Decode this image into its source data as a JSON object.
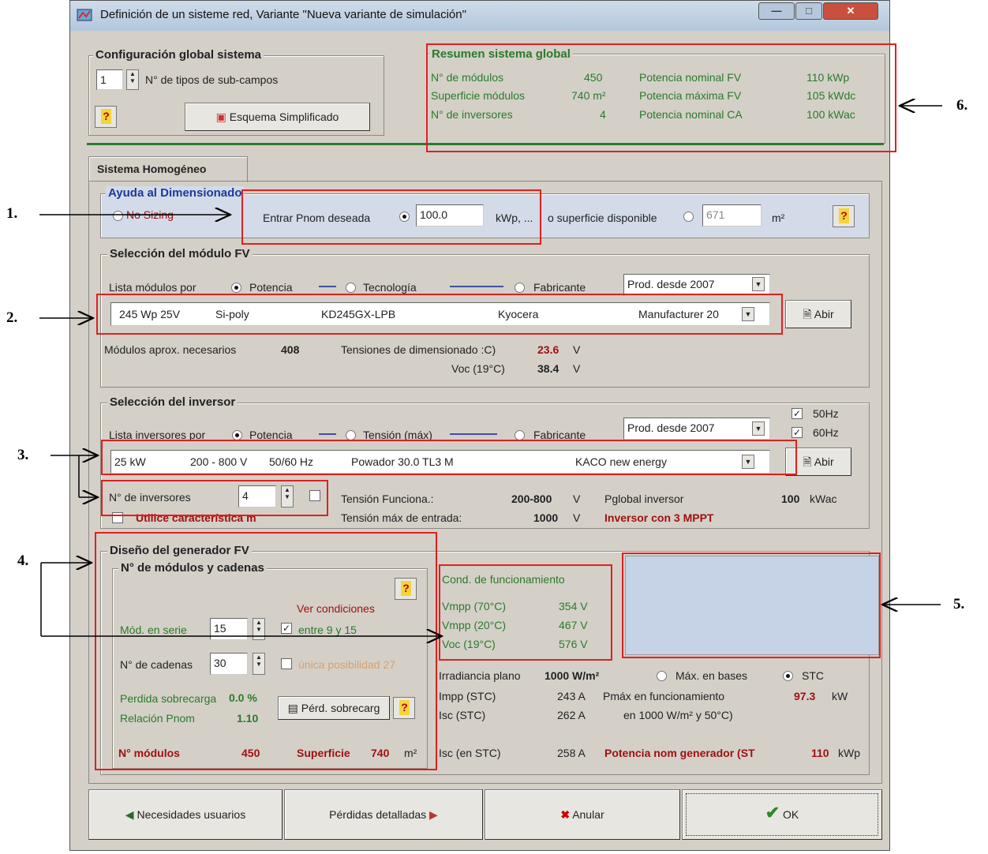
{
  "window": {
    "title": "Definición de un sisteme red, Variante   \"Nueva variante de simulación\""
  },
  "global_config": {
    "title": "Configuración global sistema",
    "subfield_count": "1",
    "subfield_label": "N° de tipos de sub-campos",
    "help": "?",
    "scheme_button": "Esquema Simplificado"
  },
  "summary": {
    "title": "Resumen sistema global",
    "rows": [
      {
        "label": "N° de módulos",
        "value": "450",
        "label2": "Potencia nominal FV",
        "value2": "110 kWp"
      },
      {
        "label": "Superficie módulos",
        "value": "740 m²",
        "label2": "Potencia máxima FV",
        "value2": "105 kWdc"
      },
      {
        "label": "N° de inversores",
        "value": "4",
        "label2": "Potencia nominal CA",
        "value2": "100 kWac"
      }
    ]
  },
  "tab": {
    "label": "Sistema Homogéneo"
  },
  "sizing": {
    "title": "Ayuda al Dimensionado",
    "no_sizing": "No Sizing",
    "enter_pnom": "Entrar Pnom deseada",
    "pnom_value": "100.0",
    "unit_kwp": "kWp, ...",
    "or_area": "o superficie disponible",
    "area_value": "671",
    "area_unit": "m²",
    "help": "?"
  },
  "module": {
    "title": "Selección del módulo FV",
    "list_by": "Lista módulos por",
    "opt_power": "Potencia",
    "opt_tech": "Tecnología",
    "opt_maker": "Fabricante",
    "filter": "Prod. desde 2007",
    "selected": {
      "power": "245 Wp 25V",
      "tech": "Si-poly",
      "model": "KD245GX-LPB",
      "maker": "Kyocera",
      "source": "Manufacturer 20"
    },
    "open": "Abir",
    "needed_label": "Módulos aprox. necesarios",
    "needed_value": "408",
    "volt_label": "Tensiones de dimensionado :C)",
    "volt_value": "23.6",
    "voc_label": "Voc  (19°C)",
    "voc_value": "38.4",
    "unit_v": "V"
  },
  "inverter": {
    "title": "Selección del inversor",
    "list_by": "Lista inversores por",
    "opt_power": "Potencia",
    "opt_volt": "Tensión (máx)",
    "opt_maker": "Fabricante",
    "filter": "Prod. desde 2007",
    "hz50": "50Hz",
    "hz60": "60Hz",
    "selected": {
      "power": "25 kW",
      "range": "200 - 800 V",
      "freq": "50/60 Hz",
      "model": "Powador 30.0 TL3 M",
      "maker": "KACO new energy"
    },
    "open": "Abir",
    "count_label": "N° de inversores",
    "count_value": "4",
    "use_char": "Utilice característica m",
    "op_volt_label": "Tensión Funciona.:",
    "op_volt_value": "200-800",
    "max_volt_label": "Tensión máx de entrada:",
    "max_volt_value": "1000",
    "unit_v": "V",
    "pglobal_label": "Pglobal inversor",
    "pglobal_value": "100",
    "pglobal_unit": "kWac",
    "mppt": "Inversor con 3 MPPT"
  },
  "generator": {
    "title": "Diseño del generador FV",
    "sub_title": "N° de módulos y cadenas",
    "help": "?",
    "see_conditions": "Ver condiciones",
    "series_label": "Mód. en serie",
    "series_value": "15",
    "between": "entre 9 y 15",
    "strings_label": "N° de cadenas",
    "strings_value": "30",
    "only_possibility": "única posibilidad 27",
    "overload_label": "Perdida sobrecarga",
    "overload_value": "0.0 %",
    "ratio_label": "Relación Pnom",
    "ratio_value": "1.10",
    "overload_button": "Pérd. sobrecarg",
    "modules_label": "N° módulos",
    "modules_value": "450",
    "area_label": "Superficie",
    "area_value": "740",
    "area_unit": "m²"
  },
  "operating": {
    "title": "Cond. de funcionamiento",
    "rows": [
      {
        "label": "Vmpp (70°C)",
        "value": "354 V"
      },
      {
        "label": "Vmpp (20°C)",
        "value": "467 V"
      },
      {
        "label": "Voc  (19°C)",
        "value": "576 V"
      }
    ],
    "irr_label": "Irradiancia plano",
    "irr_value": "1000 W/m²",
    "max_bases": "Máx. en bases",
    "stc": "STC",
    "impp_label": "Impp (STC)",
    "impp_value": "243 A",
    "pmax_label": "Pmáx en funcionamiento",
    "pmax_value": "97.3",
    "pmax_unit": "kW",
    "isc_label": "Isc  (STC)",
    "isc_value": "262 A",
    "pmax_cond": "en 1000 W/m² y 50°C)",
    "isc2_label": "Isc (en STC)",
    "isc2_value": "258 A",
    "pnom_gen_label": "Potencia nom generador (ST",
    "pnom_gen_value": "110",
    "pnom_gen_unit": "kWp"
  },
  "footer": {
    "needs": "Necesidades usuarios",
    "losses": "Pérdidas detalladas",
    "cancel": "Anular",
    "ok": "OK"
  },
  "callouts": [
    "1.",
    "2.",
    "3.",
    "4.",
    "5.",
    "6."
  ],
  "colors": {
    "highlight": "#e02020",
    "green_text": "#2a7a2a",
    "red_text": "#a01010"
  }
}
